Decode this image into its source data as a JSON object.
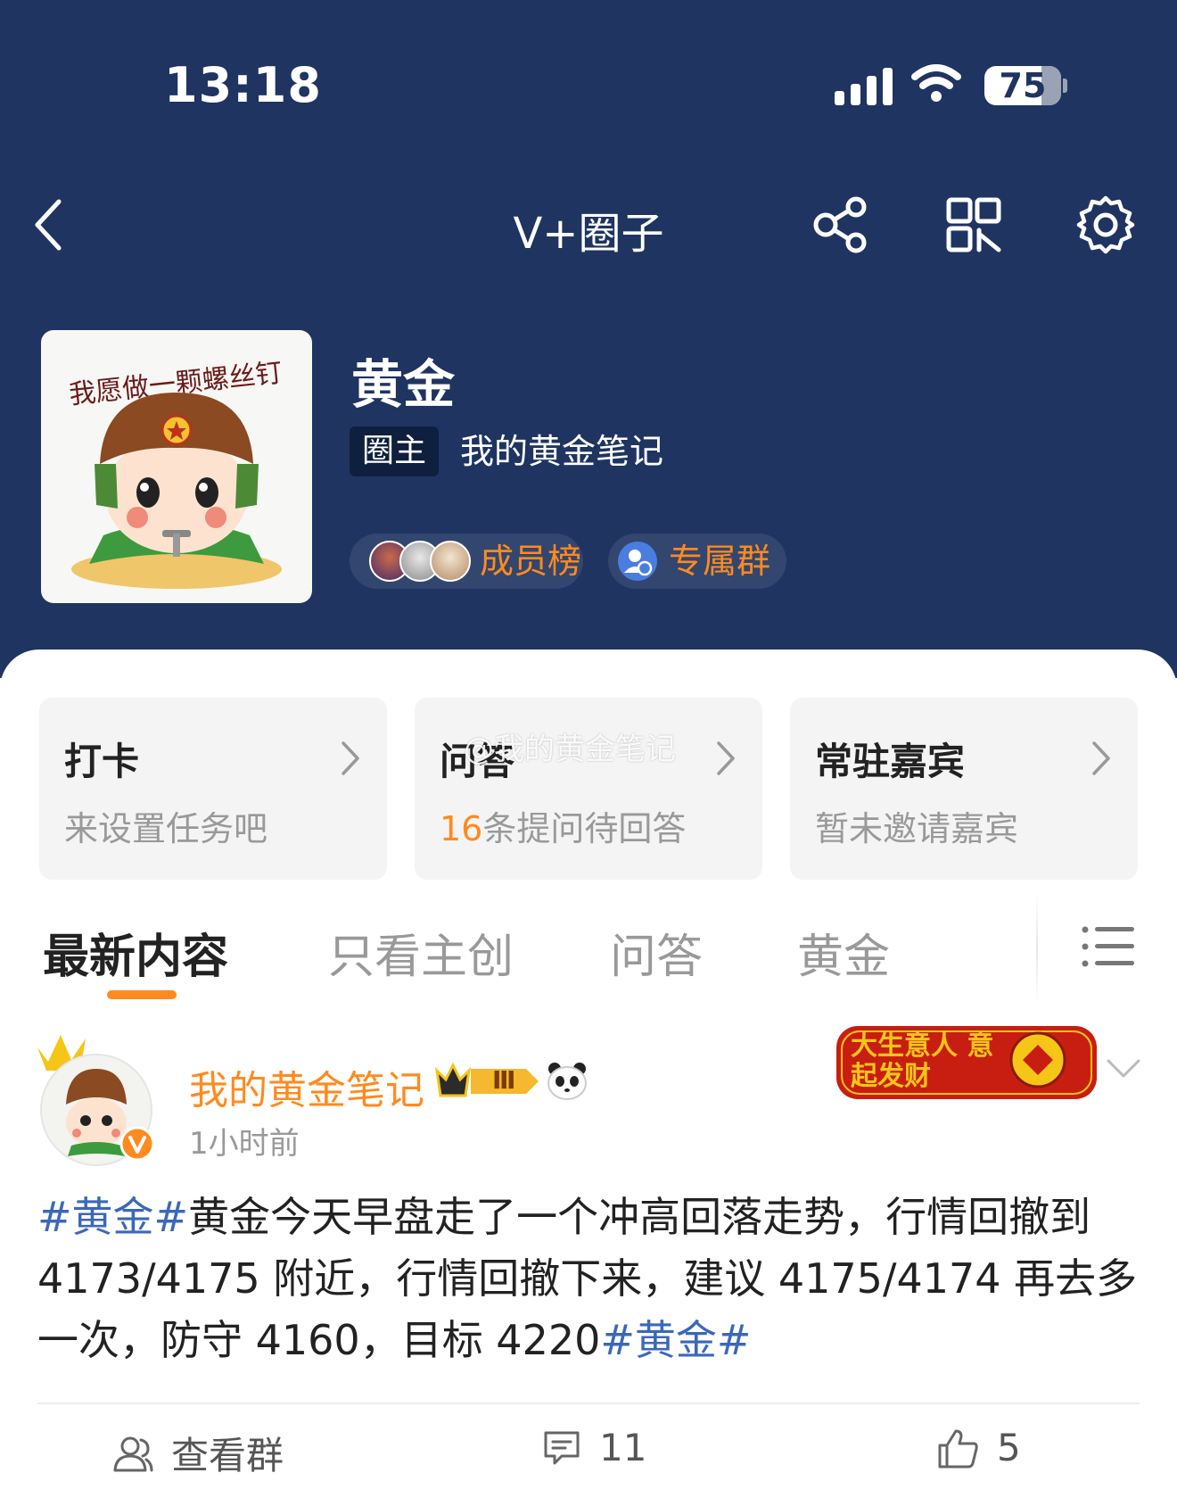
{
  "status_bar": {
    "time": "13:18",
    "battery": "75"
  },
  "nav": {
    "title": "V+圈子",
    "icons": [
      "back-icon",
      "share-icon",
      "qr-code-icon",
      "settings-icon"
    ]
  },
  "circle": {
    "name": "黄金",
    "owner_tag": "圈主",
    "owner_name": "我的黄金笔记",
    "members_label": "成员榜",
    "group_label": "专属群",
    "avatar_text": "我愿做一颗螺丝钉"
  },
  "cards": [
    {
      "title": "打卡",
      "subtitle": "来设置任务吧"
    },
    {
      "title": "问答",
      "subtitle_highlight": "16",
      "subtitle": "条提问待回答"
    },
    {
      "title": "常驻嘉宾",
      "subtitle": "暂未邀请嘉宾"
    }
  ],
  "watermark": "@我的黄金笔记",
  "tabs": [
    "最新内容",
    "只看主创",
    "问答",
    "黄金"
  ],
  "post": {
    "author": "我的黄金笔记",
    "time": "1小时前",
    "level_badge": "Ⅲ",
    "banner_text": "大生意人 意起发财",
    "topic_start": "#黄金#",
    "content": "黄金今天早盘走了一个冲高回落走势，行情回撤到 4173/4175 附近，行情回撤下来，建议 4175/4174 再去多一次，防守 4160，目标 4220",
    "topic_end": "#黄金#"
  },
  "actions": {
    "group": "查看群",
    "comments": "11",
    "likes": "5"
  },
  "colors": {
    "header_bg": "#1f3461",
    "accent": "#ff8a1f",
    "topic": "#3b68b8"
  }
}
